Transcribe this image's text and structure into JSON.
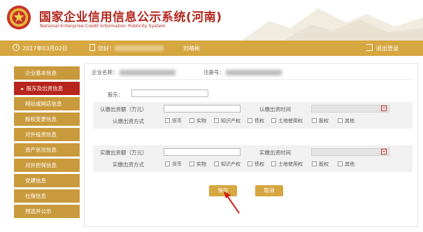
{
  "header": {
    "title_cn": "国家企业信用信息公示系统(河南)",
    "title_en": "National Enterprise Credit Information Publicity System"
  },
  "topbar": {
    "date": "2017年03月02日",
    "greeting": "您好！",
    "username": "刘萌彬",
    "logout": "退出登录"
  },
  "sidebar": {
    "items": [
      {
        "label": "企业基本信息",
        "active": false
      },
      {
        "label": "股东及出资信息",
        "active": true
      },
      {
        "label": "网站或网店信息",
        "active": false
      },
      {
        "label": "股权变更信息",
        "active": false
      },
      {
        "label": "对外投资信息",
        "active": false
      },
      {
        "label": "资产状况信息",
        "active": false
      },
      {
        "label": "对外担保信息",
        "active": false
      },
      {
        "label": "党建信息",
        "active": false
      },
      {
        "label": "社保信息",
        "active": false
      },
      {
        "label": "预选并公示",
        "active": false
      }
    ]
  },
  "form": {
    "company_name_label": "企业名称：",
    "reg_no_label": "注册号：",
    "shareholder_label": "股东：",
    "subscribed": {
      "amount_label": "认缴出资额（万元）",
      "time_label": "认缴出资时间",
      "method_label": "认缴出资方式"
    },
    "paid": {
      "amount_label": "实缴出资额（万元）",
      "time_label": "实缴出资时间",
      "method_label": "实缴出资方式"
    },
    "methods": [
      "货币",
      "实物",
      "知识产权",
      "债权",
      "土地使用权",
      "股权",
      "其他"
    ],
    "save_label": "保存",
    "cancel_label": "取消"
  },
  "colors": {
    "brand_red": "#b3261e",
    "gold": "#d6a640",
    "nav_gold": "#c99a3c"
  }
}
